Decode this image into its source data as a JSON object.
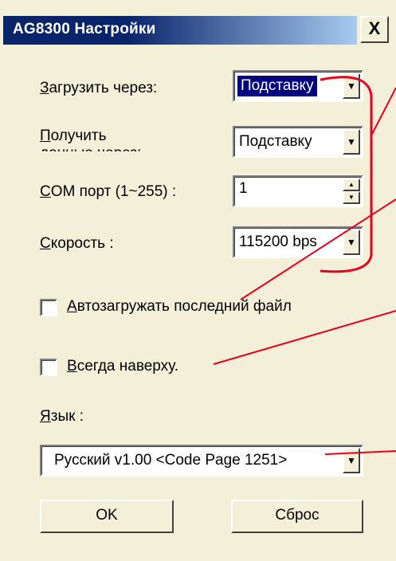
{
  "window": {
    "title": "AG8300 Настройки",
    "close_label": "X"
  },
  "fields": {
    "load_via": {
      "label_u": "З",
      "label_rest": "агрузить через:",
      "value": "Подставку"
    },
    "receive_via": {
      "label_u": "П",
      "label_rest": "олучить данные через:",
      "value": "Подставку"
    },
    "com_port": {
      "label_u": "C",
      "label_rest": "OM порт (1~255) :",
      "value": "1"
    },
    "speed": {
      "label_u": "С",
      "label_rest": "корость :",
      "value": "115200 bps"
    }
  },
  "options": {
    "autoload": {
      "label_u": "А",
      "label_rest": "втозагружать последний файл",
      "checked": false
    },
    "always_on_top": {
      "label_u": "В",
      "label_rest": "сегда наверху.",
      "checked": false
    }
  },
  "language": {
    "label_u": "Я",
    "label_rest": "зык :",
    "value": "Русский v1.00 <Code Page 1251>"
  },
  "buttons": {
    "ok": "OK",
    "reset": "Сброс"
  },
  "colors": {
    "annotation": "#e8001c",
    "titlebar": "#0a246a",
    "dialog_bg": "#f4efd8"
  },
  "icons": {
    "dropdown": "chevron-down-icon",
    "spin_up": "arrow-up-icon",
    "spin_down": "arrow-down-icon",
    "close": "close-icon"
  }
}
